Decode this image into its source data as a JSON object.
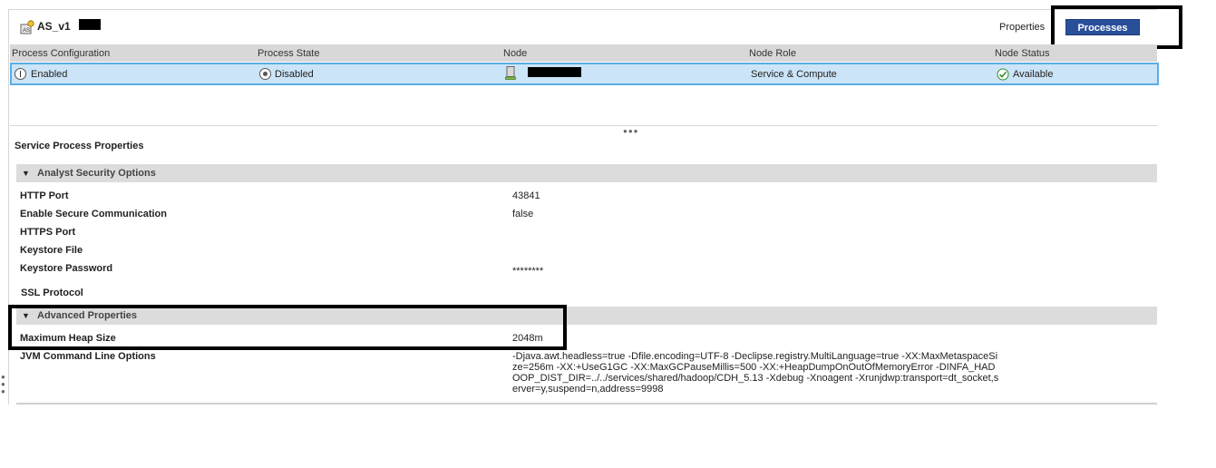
{
  "header": {
    "service_name": "AS_v1",
    "properties_label": "Properties",
    "processes_label": "Processes"
  },
  "grid": {
    "columns": [
      "Process Configuration",
      "Process State",
      "Node",
      "Node Role",
      "Node Status"
    ],
    "row": {
      "process_configuration": "Enabled",
      "process_state": "Disabled",
      "node": "",
      "node_role": "Service & Compute",
      "node_status": "Available"
    }
  },
  "splitter": {
    "dots": "●●●"
  },
  "service_process": {
    "title": "Service Process Properties",
    "analyst_security": {
      "label": "Analyst Security Options",
      "items": [
        {
          "label": "HTTP Port",
          "value": "43841"
        },
        {
          "label": "Enable Secure Communication",
          "value": "false"
        },
        {
          "label": "HTTPS Port",
          "value": ""
        },
        {
          "label": "Keystore File",
          "value": ""
        },
        {
          "label": "Keystore Password",
          "value": "********"
        },
        {
          "label": "SSL Protocol",
          "value": ""
        }
      ]
    },
    "advanced": {
      "label": "Advanced Properties",
      "items": [
        {
          "label": "Maximum Heap Size",
          "value": "2048m"
        },
        {
          "label": "JVM Command Line Options",
          "value": "-Djava.awt.headless=true -Dfile.encoding=UTF-8 -Declipse.registry.MultiLanguage=true -XX:MaxMetaspaceSize=256m -XX:+UseG1GC -XX:MaxGCPauseMillis=500 -XX:+HeapDumpOnOutOfMemoryError -DINFA_HADOOP_DIST_DIR=../../services/shared/hadoop/CDH_5.13 -Xdebug -Xnoagent -Xrunjdwp:transport=dt_socket,server=y,suspend=n,address=9998"
        }
      ]
    }
  },
  "icons": {
    "service": "service-icon",
    "enabled": "power-icon",
    "disabled": "radio-icon",
    "node": "computer-icon",
    "available": "check-icon",
    "collapse": "triangle-down-icon"
  },
  "colors": {
    "processes_button": "#2a4f9a",
    "selected_row": "#cce4f7",
    "selected_border": "#5aaee6",
    "group_bar": "#dcdcdc"
  }
}
